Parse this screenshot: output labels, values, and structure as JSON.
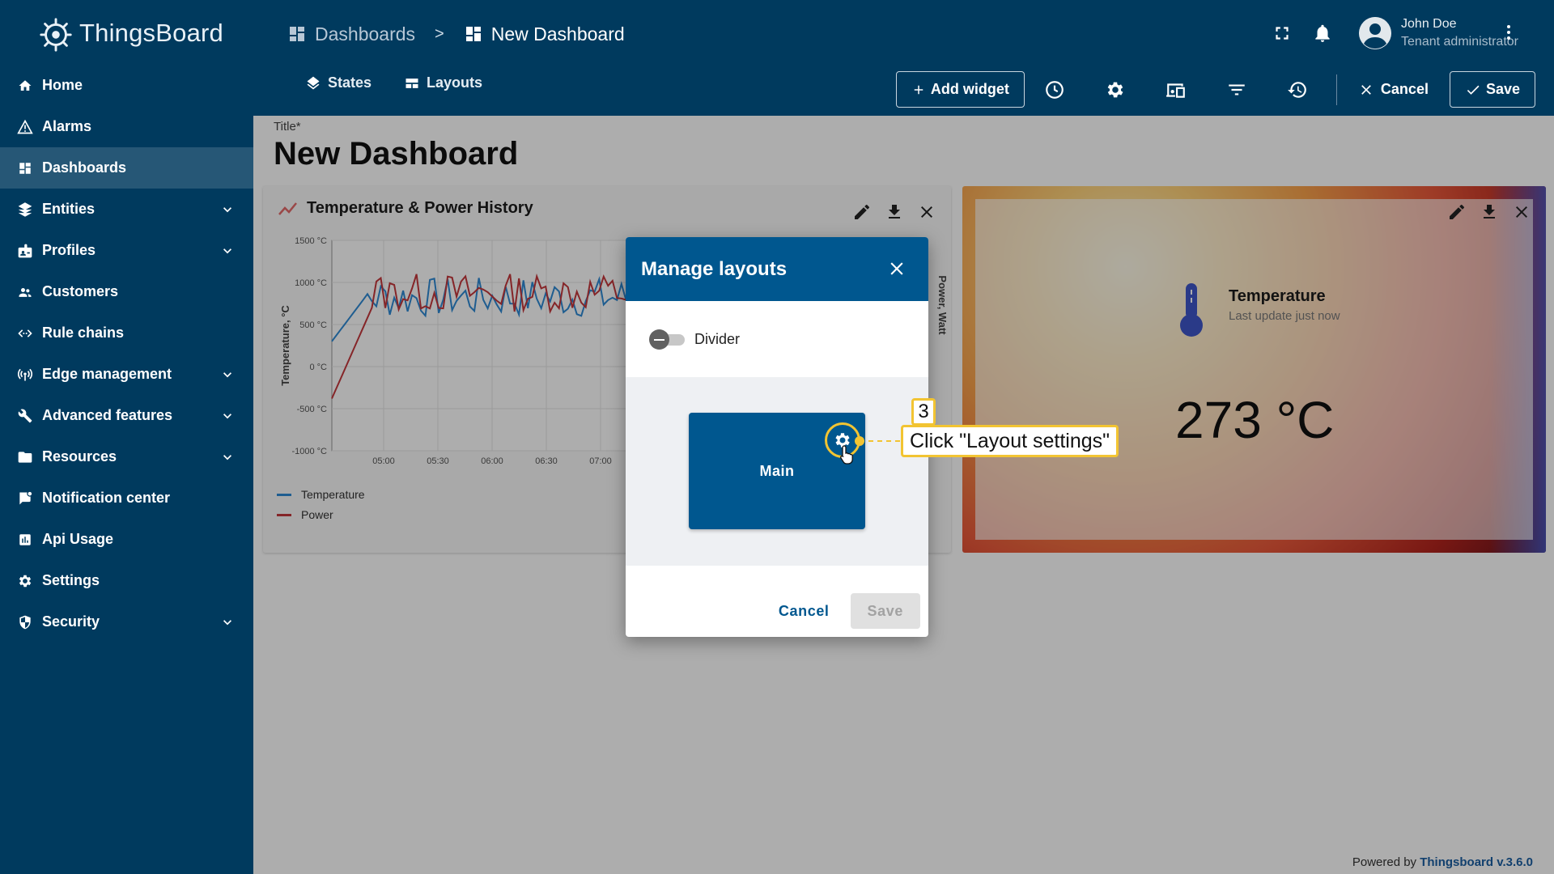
{
  "app": {
    "name": "ThingsBoard"
  },
  "breadcrumb": {
    "parent": "Dashboards",
    "separator": ">",
    "current": "New Dashboard"
  },
  "user": {
    "name": "John Doe",
    "role": "Tenant administrator"
  },
  "sidebar": {
    "items": [
      {
        "label": "Home",
        "icon": "home-icon",
        "expandable": false,
        "active": false
      },
      {
        "label": "Alarms",
        "icon": "warning-icon",
        "expandable": false,
        "active": false
      },
      {
        "label": "Dashboards",
        "icon": "dashboard-icon",
        "expandable": false,
        "active": true
      },
      {
        "label": "Entities",
        "icon": "entities-icon",
        "expandable": true,
        "active": false
      },
      {
        "label": "Profiles",
        "icon": "profiles-icon",
        "expandable": true,
        "active": false
      },
      {
        "label": "Customers",
        "icon": "customers-icon",
        "expandable": false,
        "active": false
      },
      {
        "label": "Rule chains",
        "icon": "rule-chains-icon",
        "expandable": false,
        "active": false
      },
      {
        "label": "Edge management",
        "icon": "edge-icon",
        "expandable": true,
        "active": false
      },
      {
        "label": "Advanced features",
        "icon": "tools-icon",
        "expandable": true,
        "active": false
      },
      {
        "label": "Resources",
        "icon": "folder-icon",
        "expandable": true,
        "active": false
      },
      {
        "label": "Notification center",
        "icon": "notification-icon",
        "expandable": false,
        "active": false
      },
      {
        "label": "Api Usage",
        "icon": "chart-icon",
        "expandable": false,
        "active": false
      },
      {
        "label": "Settings",
        "icon": "gear-icon",
        "expandable": false,
        "active": false
      },
      {
        "label": "Security",
        "icon": "shield-icon",
        "expandable": true,
        "active": false
      }
    ]
  },
  "toolbar": {
    "states_label": "States",
    "layouts_label": "Layouts",
    "add_widget_label": "Add widget",
    "cancel_label": "Cancel",
    "save_label": "Save"
  },
  "dashboard": {
    "title_label": "Title*",
    "title": "New Dashboard"
  },
  "chart_widget": {
    "title": "Temperature & Power History",
    "y_label": "Temperature, °C",
    "y2_label": "Power, Watt",
    "legend": [
      "Temperature",
      "Power"
    ]
  },
  "chart_data": {
    "type": "line",
    "title": "Temperature & Power History",
    "ylabel": "Temperature, °C",
    "y2label": "Power, Watt",
    "ylim": [
      -1000,
      1500
    ],
    "yticks": [
      "1500 °C",
      "1000 °C",
      "500 °C",
      "0 °C",
      "-500 °C",
      "-1000 °C"
    ],
    "xticks": [
      "05:00",
      "05:30",
      "06:00",
      "06:30",
      "07:00"
    ],
    "legend_position": "bottom-left",
    "series": [
      {
        "name": "Temperature",
        "color": "#2f8ad4"
      },
      {
        "name": "Power",
        "color": "#c4373c"
      }
    ]
  },
  "temp_widget": {
    "label": "Temperature",
    "subtitle": "Last update just now",
    "value": "273 °C"
  },
  "dialog": {
    "title": "Manage layouts",
    "toggle_label": "Divider",
    "layout_name": "Main",
    "cancel_label": "Cancel",
    "save_label": "Save"
  },
  "tutorial": {
    "step": "3",
    "text": "Click \"Layout settings\""
  },
  "footer": {
    "prefix": "Powered by",
    "link": "Thingsboard v.3.6.0"
  },
  "colors": {
    "sidebar_bg": "#003a5e",
    "dialog_header": "#00578f",
    "accent_yellow": "#f2c432"
  }
}
